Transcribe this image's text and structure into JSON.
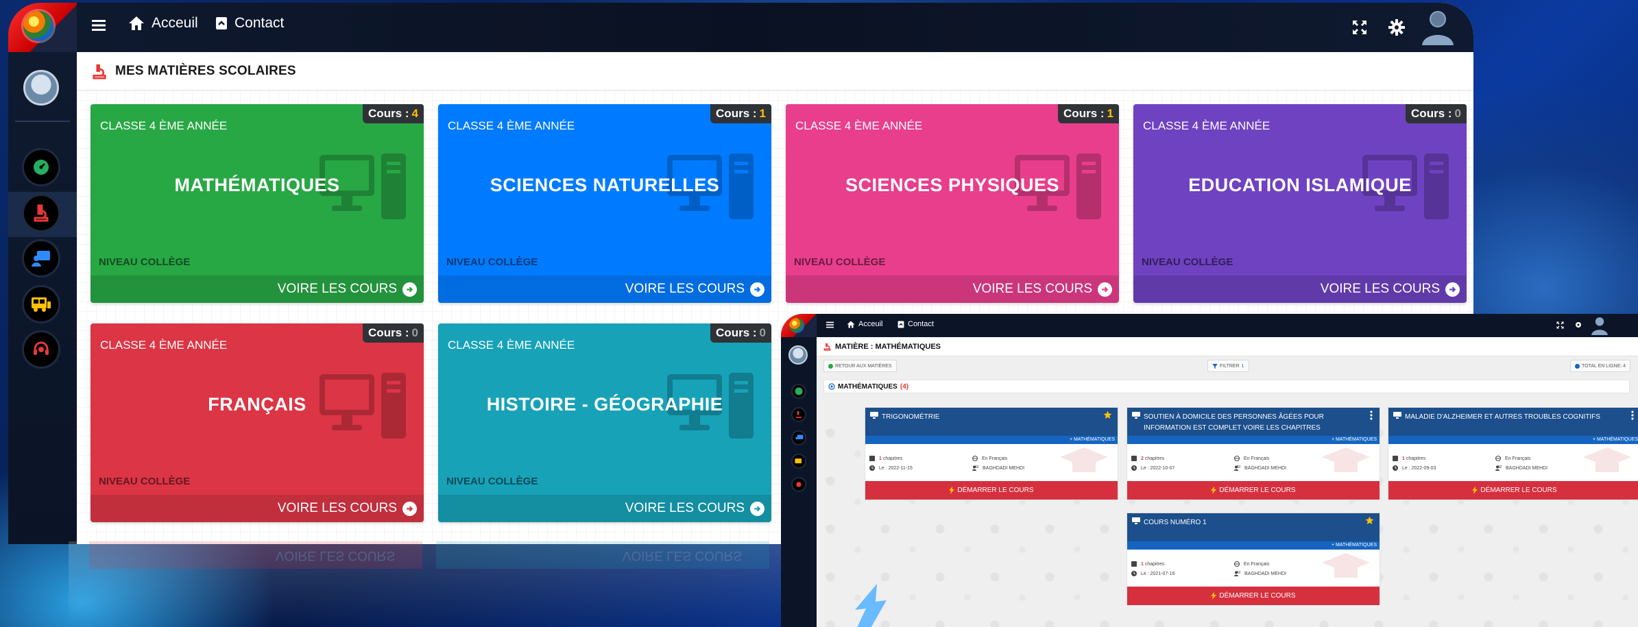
{
  "main": {
    "nav": {
      "home": "Acceuil",
      "contact": "Contact"
    },
    "page_title": "MES MATIÈRES SCOLAIRES",
    "subjects": [
      {
        "classe": "CLASSE 4 ÈME ANNÉE",
        "name": "MATHÉMATIQUES",
        "cours_label": "Cours :",
        "count": "4",
        "niveau": "NIVEAU COLLÈGE",
        "cta": "VOIRE LES COURS",
        "color": "#28a745"
      },
      {
        "classe": "CLASSE 4 ÈME ANNÉE",
        "name": "SCIENCES NATURELLES",
        "cours_label": "Cours :",
        "count": "1",
        "niveau": "NIVEAU COLLÈGE",
        "cta": "VOIRE LES COURS",
        "color": "#007bff"
      },
      {
        "classe": "CLASSE 4 ÈME ANNÉE",
        "name": "SCIENCES PHYSIQUES",
        "cours_label": "Cours :",
        "count": "1",
        "niveau": "NIVEAU COLLÈGE",
        "cta": "VOIRE LES COURS",
        "color": "#e83e8c"
      },
      {
        "classe": "CLASSE 4 ÈME ANNÉE",
        "name": "EDUCATION ISLAMIQUE",
        "cours_label": "Cours :",
        "count": "0",
        "niveau": "NIVEAU COLLÈGE",
        "cta": "VOIRE LES COURS",
        "color": "#6f42c1"
      },
      {
        "classe": "CLASSE 4 ÈME ANNÉE",
        "name": "FRANÇAIS",
        "cours_label": "Cours :",
        "count": "0",
        "niveau": "NIVEAU COLLÈGE",
        "cta": "VOIRE LES COURS",
        "color": "#dc3545"
      },
      {
        "classe": "CLASSE 4 ÈME ANNÉE",
        "name": "HISTOIRE - GÉOGRAPHIE",
        "cours_label": "Cours :",
        "count": "0",
        "niveau": "NIVEAU COLLÈGE",
        "cta": "VOIRE LES COURS",
        "color": "#17a2b8"
      }
    ],
    "reflection": {
      "cta": "VOIRE LES COURS",
      "niveau": "NIVEAU COLLÈGE"
    }
  },
  "inset": {
    "nav": {
      "home": "Acceuil",
      "contact": "Contact"
    },
    "page_title": "MATIÈRE : MATHÉMATIQUES",
    "back_label": "RETOUR AUX MATIÈRES",
    "filter_label": "FILTRER",
    "filter_count": "1",
    "total_label": "TOTAL EN LIGNE: 4",
    "section_title": "MATHÉMATIQUES",
    "section_count": "(4)",
    "courses": [
      {
        "title": "TRIGONOMÉTRIE",
        "tag": "+ MATHÉMATIQUES",
        "chapters": "1",
        "chapters_label": "chapitres",
        "language": "En Français",
        "date": "Le : 2022-11-15",
        "author": "BAGHDADI MEHDI",
        "action": "DÉMARRER LE COURS",
        "favorite": true
      },
      {
        "title": "SOUTIEN À DOMICILE DES PERSONNES ÂGÉES POUR INFORMATION EST COMPLET VOIRE LES CHAPITRES",
        "tag": "+ MATHÉMATIQUES",
        "chapters": "2",
        "chapters_label": "chapitres",
        "language": "En Français",
        "date": "Le : 2022-10-07",
        "author": "BAGHDADI MEHDI",
        "action": "DÉMARRER LE COURS",
        "favorite": false
      },
      {
        "title": "MALADIE D'ALZHEIMER ET AUTRES TROUBLES COGNITIFS",
        "tag": "+ MATHÉMATIQUES",
        "chapters": "1",
        "chapters_label": "chapitres",
        "language": "En Français",
        "date": "Le : 2022-09-03",
        "author": "BAGHDADI MEHDI",
        "action": "DÉMARRER LE COURS",
        "favorite": false
      },
      {
        "title": "COURS NUMÉRO 1",
        "tag": "+ MATHÉMATIQUES",
        "chapters": "1",
        "chapters_label": "chapitres",
        "language": "En Français",
        "date": "Le : 2021-07-16",
        "author": "BAGHDADI MEHDI",
        "action": "DÉMARRER LE COURS",
        "favorite": true
      }
    ]
  },
  "icons": {
    "sidebar": [
      "speedometer-icon",
      "subjects-icon",
      "classroom-icon",
      "bus-icon",
      "support-headset-icon"
    ],
    "top_right": [
      "fullscreen-icon",
      "settings-gear-icon",
      "user-avatar-icon"
    ]
  },
  "colors": {
    "topbar": "#0f1a30",
    "course_header": "#1c4f8c",
    "start_button": "#d6303e",
    "badge_count": "#ffc107"
  }
}
